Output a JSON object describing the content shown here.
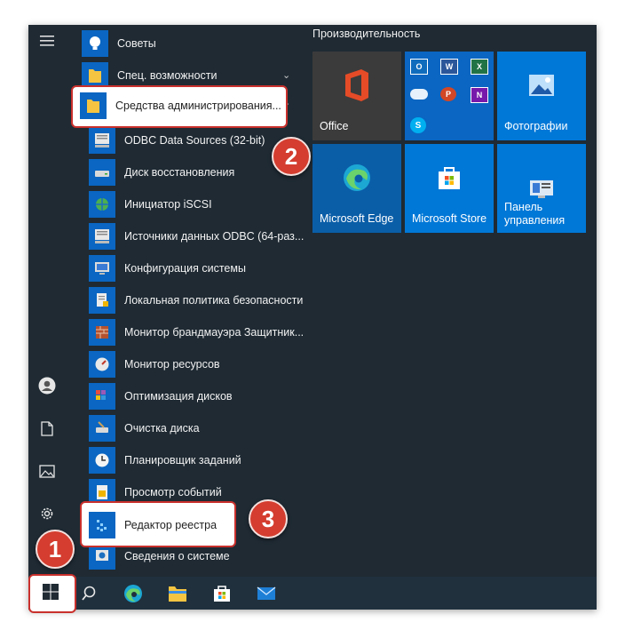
{
  "left_rail": {
    "menu_icon": "hamburger-icon",
    "user_icon": "user-icon",
    "documents_icon": "document-icon",
    "pictures_icon": "picture-icon",
    "settings_icon": "gear-icon"
  },
  "app_list": {
    "items": [
      {
        "label": "Советы",
        "icon": "bulb-icon"
      },
      {
        "label": "Спец. возможности",
        "icon": "folder-icon"
      },
      {
        "label": "Средства администрирования...",
        "icon": "folder-icon"
      }
    ],
    "sub_items": [
      {
        "label": "ODBC Data Sources (32-bit)",
        "icon": "odbc-icon"
      },
      {
        "label": "Диск восстановления",
        "icon": "drive-icon"
      },
      {
        "label": "Инициатор iSCSI",
        "icon": "globe-icon"
      },
      {
        "label": "Источники данных ODBC (64-раз...",
        "icon": "odbc-icon"
      },
      {
        "label": "Конфигурация системы",
        "icon": "monitor-icon"
      },
      {
        "label": "Локальная политика безопасности",
        "icon": "policy-icon"
      },
      {
        "label": "Монитор брандмауэра Защитник...",
        "icon": "firewall-icon"
      },
      {
        "label": "Монитор ресурсов",
        "icon": "gauge-icon"
      },
      {
        "label": "Оптимизация дисков",
        "icon": "defrag-icon"
      },
      {
        "label": "Очистка диска",
        "icon": "cleanup-icon"
      },
      {
        "label": "Планировщик заданий",
        "icon": "clock-icon"
      },
      {
        "label": "Просмотр событий",
        "icon": "event-icon"
      },
      {
        "label": "Редактор реестра",
        "icon": "registry-icon"
      },
      {
        "label": "Сведения о системе",
        "icon": "info-icon"
      }
    ]
  },
  "tiles": {
    "section_title": "Производительность",
    "office": {
      "label": "Office",
      "icon": "office-icon",
      "color": "#3b3b3b"
    },
    "office_apps": [
      "outlook-icon",
      "word-icon",
      "excel-icon",
      "onedrive-icon",
      "powerpoint-icon",
      "onenote-icon",
      "skype-icon"
    ],
    "photos": {
      "label": "Фотографии",
      "icon": "photos-icon",
      "color": "#0078d7"
    },
    "edge": {
      "label": "Microsoft Edge",
      "icon": "edge-icon",
      "color": "#0a5ea8"
    },
    "store": {
      "label": "Microsoft Store",
      "icon": "store-icon",
      "color": "#0078d7"
    },
    "control_panel": {
      "label": "Панель\nуправления",
      "line1": "Панель",
      "line2": "управления",
      "icon": "control-panel-icon",
      "color": "#0078d7"
    }
  },
  "taskbar": {
    "icons": [
      "windows-start-icon",
      "search-icon",
      "edge-icon",
      "file-explorer-icon",
      "store-icon",
      "mail-icon"
    ]
  },
  "annotations": {
    "step1": "1",
    "step2": "2",
    "step3": "3",
    "accent": "#d43d2f"
  }
}
